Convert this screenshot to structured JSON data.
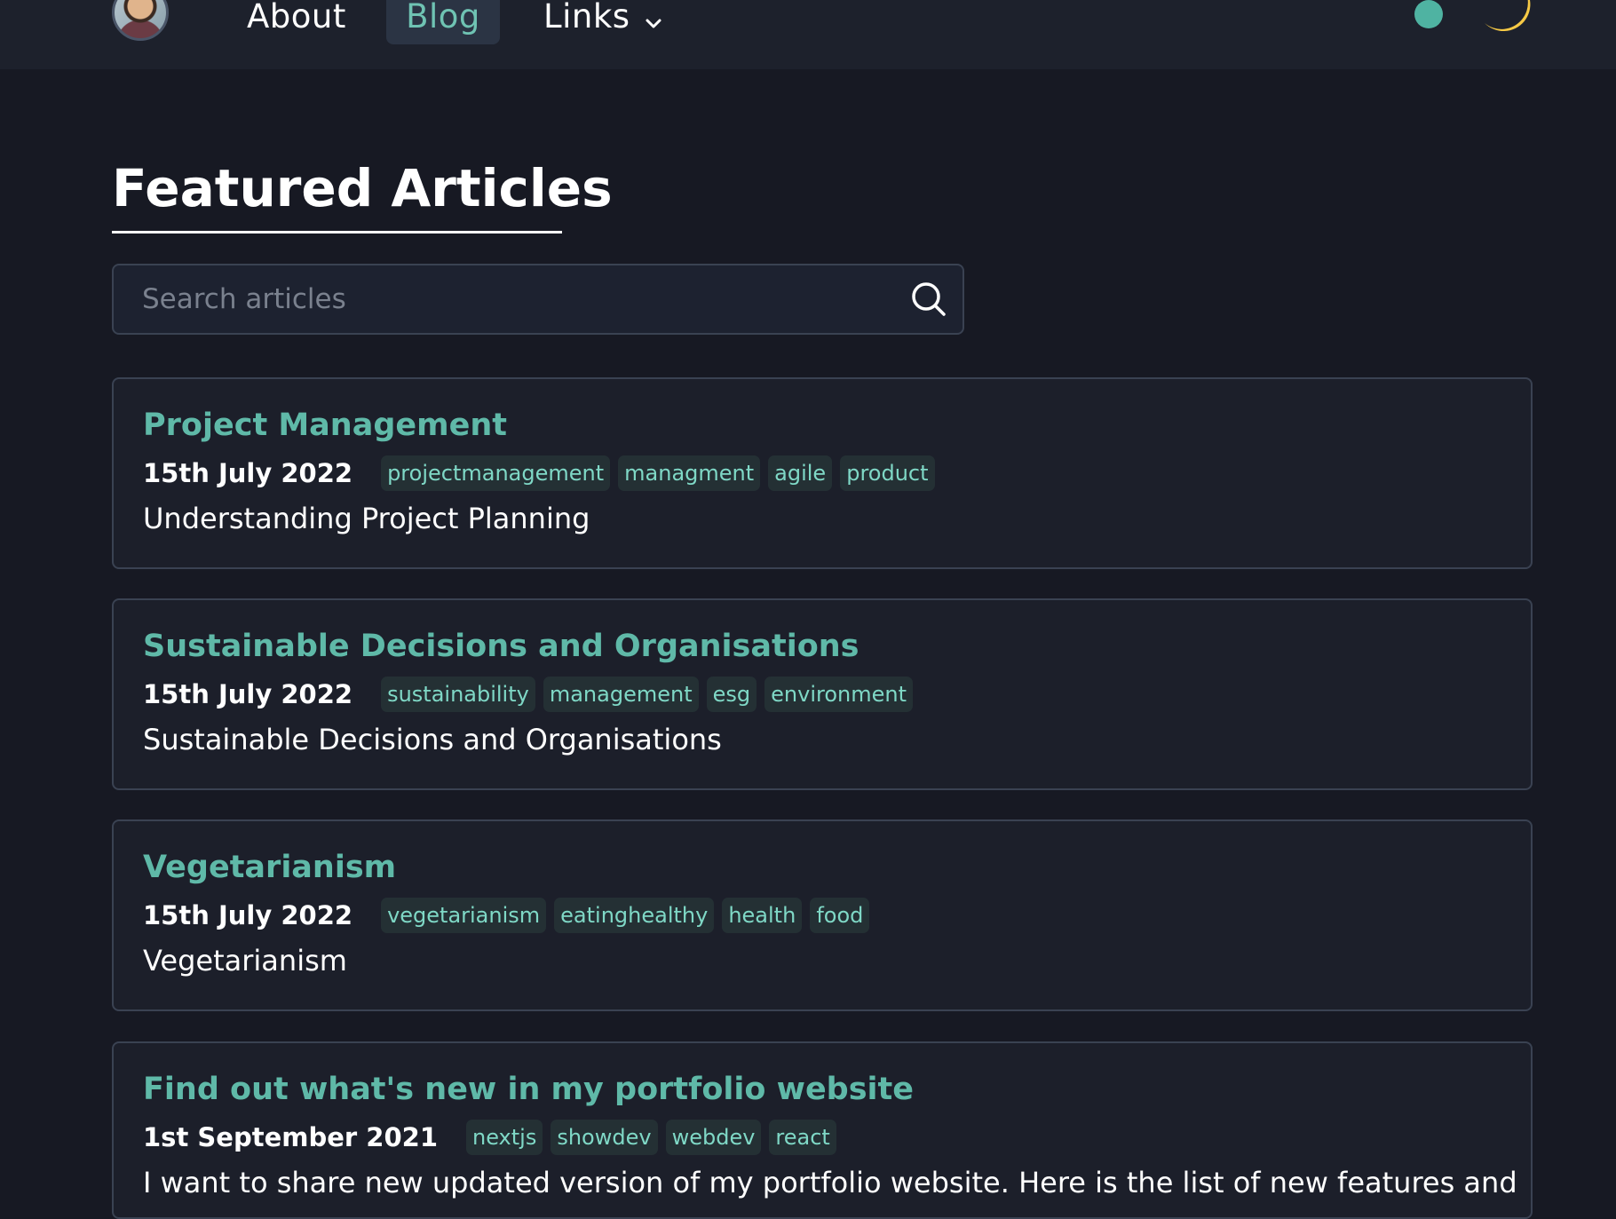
{
  "nav": {
    "items": [
      {
        "label": "About"
      },
      {
        "label": "Blog"
      },
      {
        "label": "Links"
      }
    ]
  },
  "page": {
    "heading": "Featured Articles",
    "search_placeholder": "Search articles"
  },
  "articles": [
    {
      "title": "Project Management",
      "date": "15th July 2022",
      "tags": [
        "projectmanagement",
        "managment",
        "agile",
        "product"
      ],
      "description": "Understanding Project Planning"
    },
    {
      "title": "Sustainable Decisions and Organisations",
      "date": "15th July 2022",
      "tags": [
        "sustainability",
        "management",
        "esg",
        "environment"
      ],
      "description": "Sustainable Decisions and Organisations"
    },
    {
      "title": "Vegetarianism",
      "date": "15th July 2022",
      "tags": [
        "vegetarianism",
        "eatinghealthy",
        "health",
        "food"
      ],
      "description": "Vegetarianism"
    },
    {
      "title": "Find out what's new in my portfolio website",
      "date": "1st September 2021",
      "tags": [
        "nextjs",
        "showdev",
        "webdev",
        "react"
      ],
      "description": "I want to share new updated version of my portfolio website. Here is the list of new features and"
    }
  ],
  "colors": {
    "background": "#171923",
    "accent": "#5fb9a8",
    "tag_text": "#7fd8c6",
    "moon": "#f6c945"
  }
}
